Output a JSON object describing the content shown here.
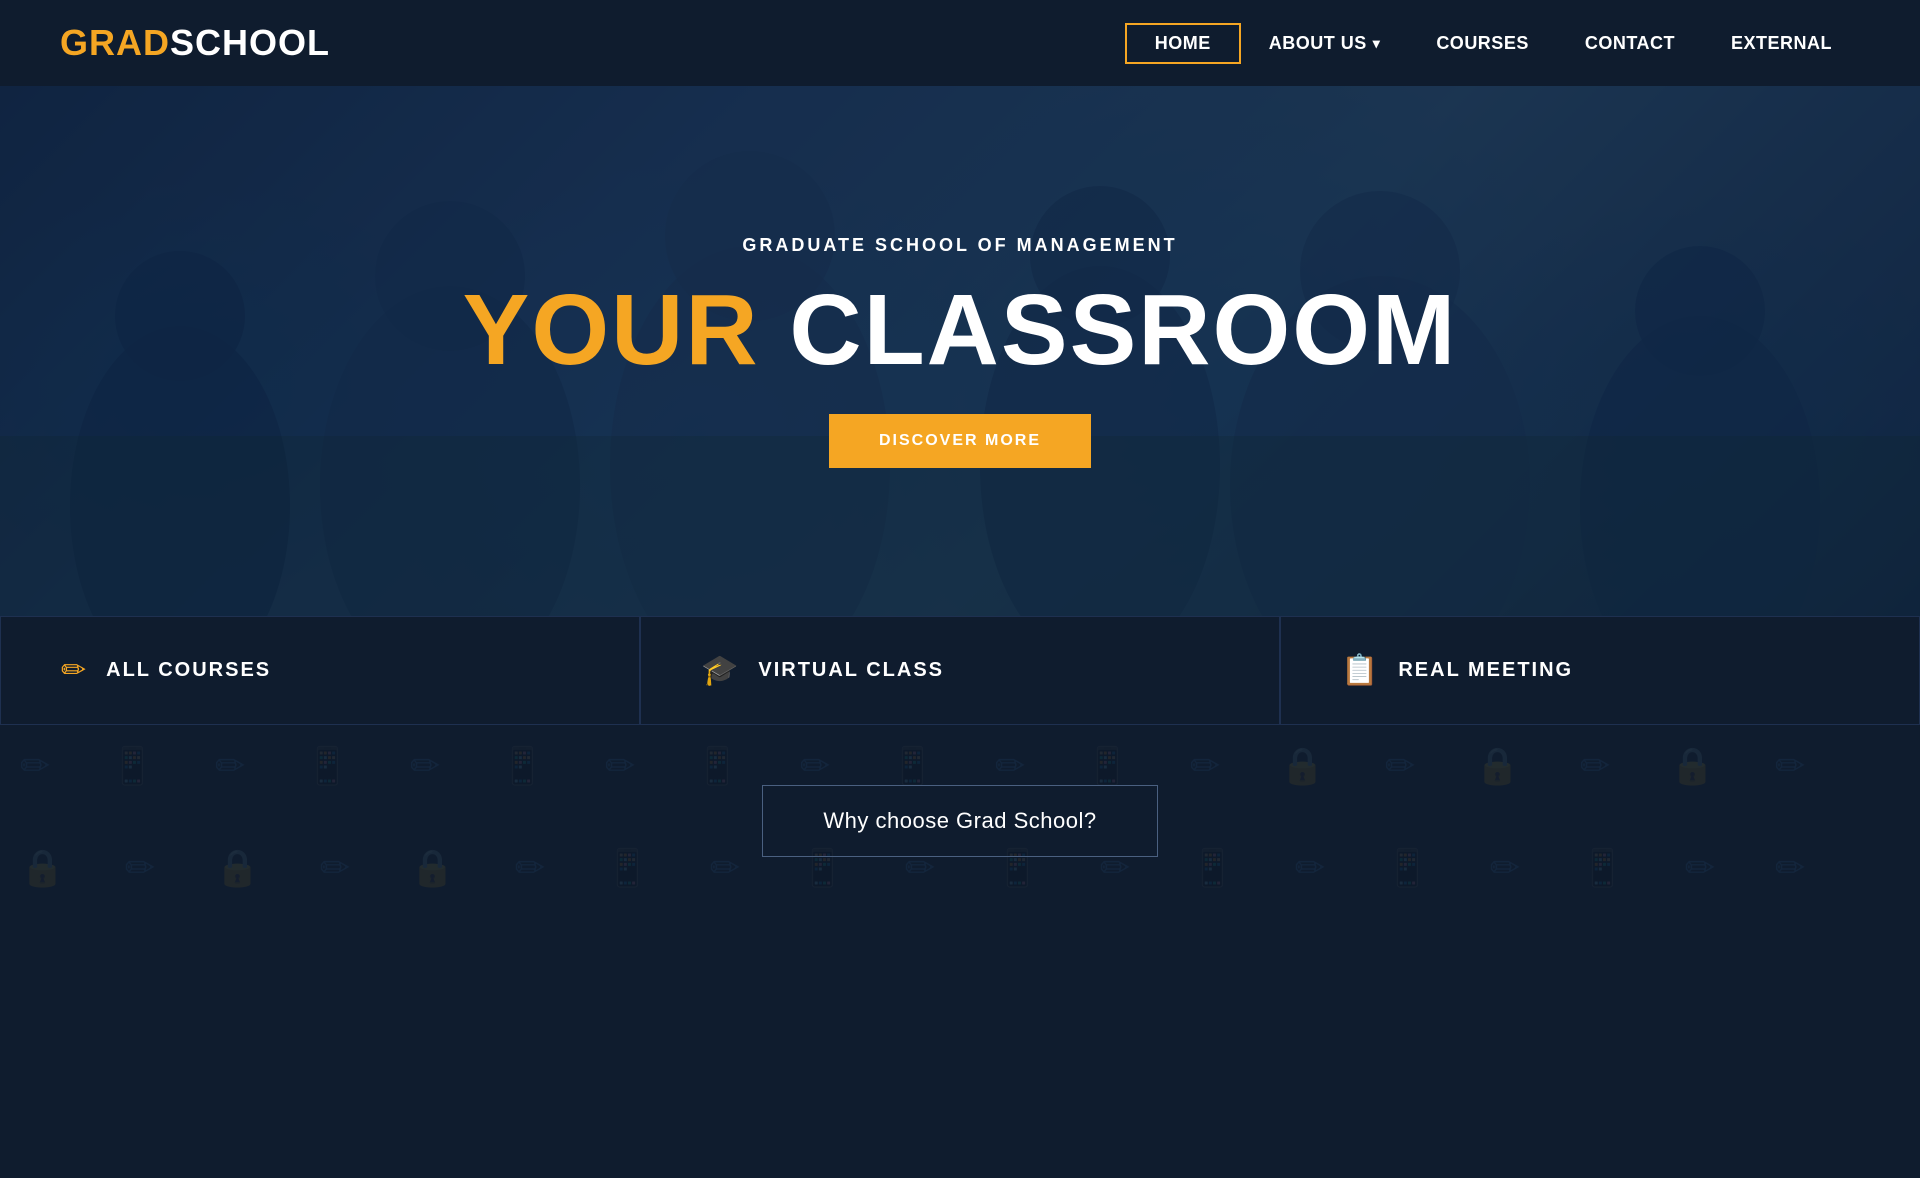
{
  "brand": {
    "grad": "GRAD",
    "school": " SCHOOL"
  },
  "nav": {
    "items": [
      {
        "id": "home",
        "label": "HOME",
        "active": true,
        "hasDropdown": false
      },
      {
        "id": "about",
        "label": "ABOUT US",
        "active": false,
        "hasDropdown": true
      },
      {
        "id": "courses",
        "label": "COURSES",
        "active": false,
        "hasDropdown": false
      },
      {
        "id": "contact",
        "label": "CONTACT",
        "active": false,
        "hasDropdown": false
      },
      {
        "id": "external",
        "label": "EXTERNAL",
        "active": false,
        "hasDropdown": false
      }
    ]
  },
  "hero": {
    "subtitle": "GRADUATE SCHOOL OF MANAGEMENT",
    "title_your": "YOUR",
    "title_classroom": " CLASSROOM",
    "discover_btn": "DISCOVER MORE"
  },
  "features": [
    {
      "id": "all-courses",
      "icon": "✏",
      "label": "ALL COURSES"
    },
    {
      "id": "virtual-class",
      "icon": "🎓",
      "label": "VIRTUAL CLASS"
    },
    {
      "id": "real-meeting",
      "icon": "📋",
      "label": "REAL MEETING"
    }
  ],
  "why_choose": {
    "label": "Why choose Grad School?"
  },
  "colors": {
    "accent": "#f5a623",
    "dark_bg": "#0f1c2e",
    "white": "#ffffff"
  }
}
